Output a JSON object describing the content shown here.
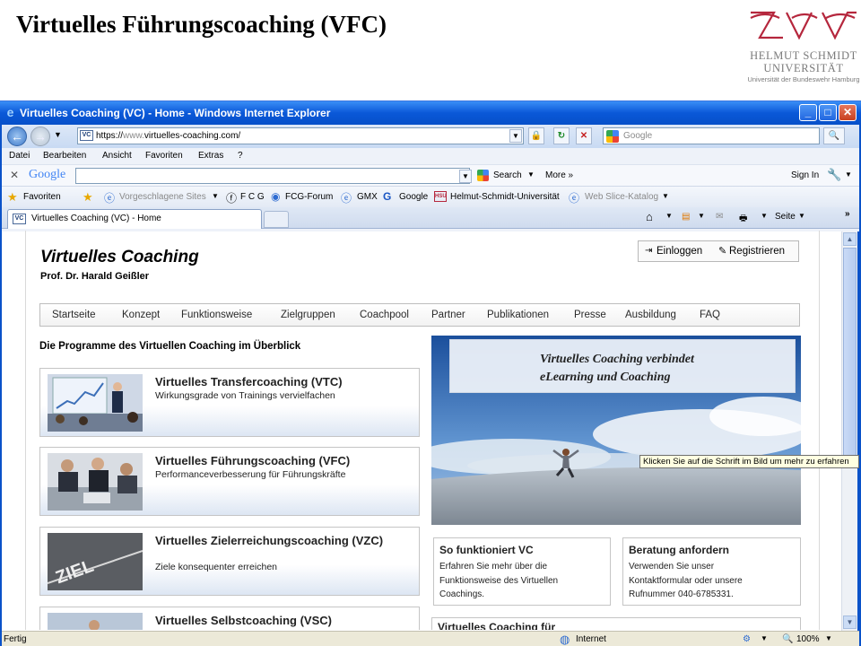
{
  "slide": {
    "title": "Virtuelles Führungscoaching (VFC)",
    "logo_line1": "HELMUT SCHMIDT",
    "logo_line2": "UNIVERSITÄT",
    "logo_line3": "Universität der Bundeswehr Hamburg"
  },
  "browser": {
    "window_title": "Virtuelles Coaching (VC) - Home - Windows Internet Explorer",
    "address_prefix": "https://",
    "address_domain": "www.",
    "address_rest": "virtuelles-coaching.com/",
    "search_placeholder": "Google",
    "menu": [
      "Datei",
      "Bearbeiten",
      "Ansicht",
      "Favoriten",
      "Extras",
      "?"
    ],
    "google_bar": {
      "logo": "Google",
      "search_label": "Search",
      "more_label": "More »",
      "sign_in": "Sign In"
    },
    "favorites": {
      "label": "Favoriten",
      "items": [
        "Vorgeschlagene Sites",
        "F C G",
        "FCG-Forum",
        "GMX",
        "Google",
        "Helmut-Schmidt-Universität",
        "Web Slice-Katalog"
      ]
    },
    "tab_label": "Virtuelles Coaching (VC) - Home",
    "page_menu": "Seite",
    "status": {
      "left": "Fertig",
      "zone": "Internet",
      "zoom": "100%"
    }
  },
  "site": {
    "title": "Virtuelles Coaching",
    "subtitle": "Prof. Dr. Harald Geißler",
    "login": "Einloggen",
    "register": "Registrieren",
    "nav": [
      "Startseite",
      "Konzept",
      "Funktionsweise",
      "Zielgruppen",
      "Coachpool",
      "Partner",
      "Publikationen",
      "Presse",
      "Ausbildung",
      "FAQ"
    ],
    "section_heading": "Die Programme des Virtuellen Coaching im Überblick",
    "programs": [
      {
        "title": "Virtuelles Transfercoaching (VTC)",
        "desc": "Wirkungsgrade von Trainings vervielfachen"
      },
      {
        "title": "Virtuelles Führungscoaching (VFC)",
        "desc": "Performanceverbesserung für Führungskräfte"
      },
      {
        "title": "Virtuelles Zielerreichungscoaching (VZC)",
        "desc": "Ziele konsequenter erreichen"
      },
      {
        "title": "Virtuelles Selbstcoaching (VSC)",
        "desc": ""
      }
    ],
    "hero_line1": "Virtuelles Coaching verbindet",
    "hero_line2": "eLearning und Coaching",
    "tooltip": "Klicken Sie auf die Schrift im Bild um mehr zu erfahren",
    "box1": {
      "title": "So funktioniert VC",
      "lines": [
        "Erfahren Sie mehr über die",
        "Funktionsweise des Virtuellen",
        "Coachings."
      ]
    },
    "box2": {
      "title": "Beratung anfordern",
      "lines": [
        "Verwenden Sie unser",
        "Kontaktformular oder unsere",
        "Rufnummer 040-6785331."
      ]
    },
    "box3": {
      "title": "Virtuelles Coaching für"
    }
  }
}
